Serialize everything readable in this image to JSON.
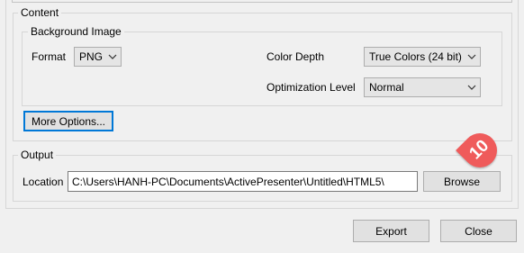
{
  "content_group": {
    "title": "Content",
    "background_image": {
      "title": "Background Image",
      "format_label": "Format",
      "format_value": "PNG",
      "color_depth_label": "Color Depth",
      "color_depth_value": "True Colors (24 bit)",
      "optimization_label": "Optimization Level",
      "optimization_value": "Normal"
    },
    "more_options_label": "More Options..."
  },
  "output_group": {
    "title": "Output",
    "location_label": "Location",
    "location_value": "C:\\Users\\HANH-PC\\Documents\\ActivePresenter\\Untitled\\HTML5\\",
    "browse_label": "Browse"
  },
  "callout": {
    "text": "10",
    "color": "#ef5b5b"
  },
  "footer": {
    "export_label": "Export",
    "close_label": "Close"
  },
  "icons": {
    "dropdown": "chevron-down-icon"
  },
  "colors": {
    "focus_border": "#0078d7",
    "window_bg": "#f0f0f0"
  }
}
